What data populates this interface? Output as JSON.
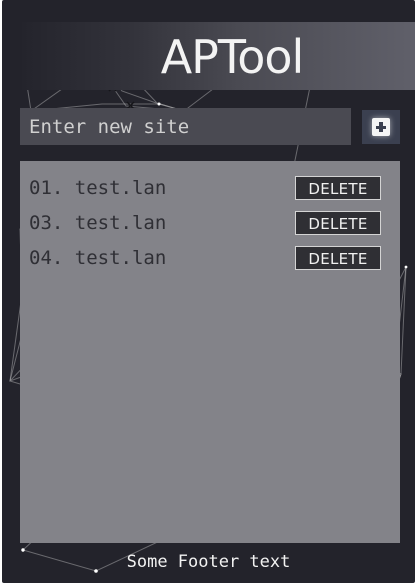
{
  "app": {
    "title": "APTool",
    "input_placeholder": "Enter new site",
    "add_icon": "plus-square-icon",
    "items": [
      {
        "number": "01.",
        "site": "test.lan",
        "delete_label": "DELETE"
      },
      {
        "number": "03.",
        "site": "test.lan",
        "delete_label": "DELETE"
      },
      {
        "number": "04.",
        "site": "test.lan",
        "delete_label": "DELETE"
      }
    ],
    "footer": "Some Footer text"
  },
  "colors": {
    "background": "#23232b",
    "panel": "#838389",
    "input": "#4a4a52",
    "text_dark": "#2f2f35",
    "text_light": "#f2f2f2"
  }
}
